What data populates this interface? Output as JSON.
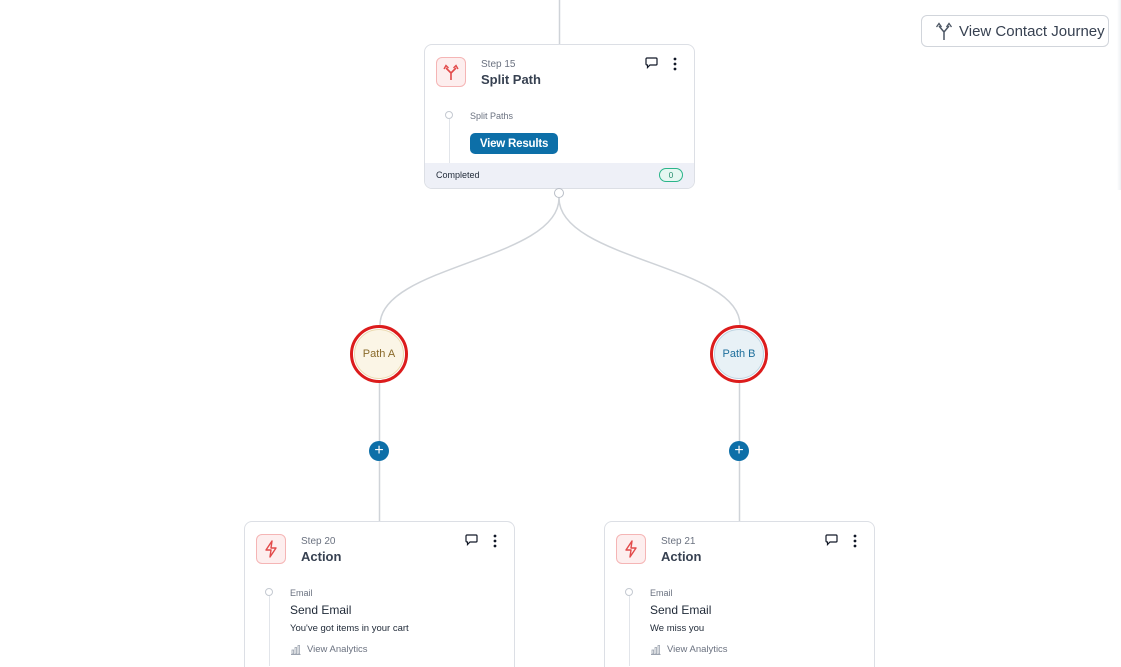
{
  "toolbar": {
    "view_contact_journey_label": "View Contact Journey",
    "icon": "branch-split-icon"
  },
  "split_step": {
    "step_label": "Step 15",
    "title": "Split Path",
    "icon": "split-path-icon",
    "sub_label": "Split Paths",
    "view_results_label": "View Results",
    "status": "Completed",
    "count": "0"
  },
  "paths": [
    {
      "label": "Path A",
      "accent": "#8a6a2a"
    },
    {
      "label": "Path B",
      "accent": "#1e6f9c"
    }
  ],
  "add_step_label": "+",
  "actions": [
    {
      "step_label": "Step 20",
      "title": "Action",
      "icon": "lightning-icon",
      "type_label": "Email",
      "name": "Send Email",
      "description": "You've got items in your cart",
      "analytics_label": "View Analytics"
    },
    {
      "step_label": "Step 21",
      "title": "Action",
      "icon": "lightning-icon",
      "type_label": "Email",
      "name": "Send Email",
      "description": "We miss you",
      "analytics_label": "View Analytics"
    }
  ],
  "colors": {
    "primary": "#0d6fa8",
    "highlight_ring": "#dc1c1c",
    "icon_accent": "#e24a4a",
    "connector": "#cfd3d8"
  }
}
